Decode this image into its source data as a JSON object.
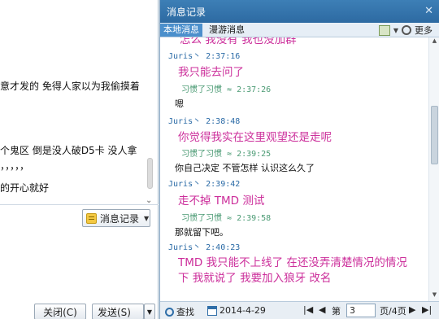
{
  "left_chat": {
    "lines": [
      "意才发的  免得人家以为我偷摸着",
      "个鬼区  倒是没人破D5卡  没人拿",
      "，，，，，",
      "的开心就好"
    ],
    "message_history_button": "消息记录",
    "close_button": "关闭(C)",
    "send_button": "发送(S)"
  },
  "history": {
    "title": "消息记录",
    "tabs": [
      "本地消息",
      "漫游消息"
    ],
    "more_label": "更多",
    "partial_top": "怎么  我没有  我也没加群",
    "messages": [
      {
        "sender": "Juris丶",
        "time": "2:37:16",
        "text": "我只能去问了",
        "reply_sender": "习惯了习惯",
        "reply_time": "2:37:26",
        "reply": "嗯"
      },
      {
        "sender": "Juris丶",
        "time": "2:38:48",
        "text": "你觉得我实在这里观望还是走呢",
        "reply_sender": "习惯了习惯",
        "reply_time": "2:39:25",
        "reply": "你自己决定  不管怎样  认识这么久了"
      },
      {
        "sender": "Juris丶",
        "time": "2:39:42",
        "text": "走不掉 TMD  测试",
        "reply_sender": "习惯了习惯",
        "reply_time": "2:39:58",
        "reply": "那就留下吧。"
      },
      {
        "sender": "Juris丶",
        "time": "2:40:23",
        "text": "TMD 我只能不上线了  在还没弄清楚情况的情况下  我就说了  我要加入狼牙  改名"
      }
    ],
    "status": {
      "find_label": "查找",
      "date": "2014-4-29",
      "page_prefix": "第",
      "page_current": "3",
      "page_suffix": "页/4页"
    }
  },
  "colors": {
    "titlebar": "#3d7fb6",
    "message": "#cc2f9b",
    "sender": "#2a6aa6",
    "reply_header": "#4a9a73"
  }
}
